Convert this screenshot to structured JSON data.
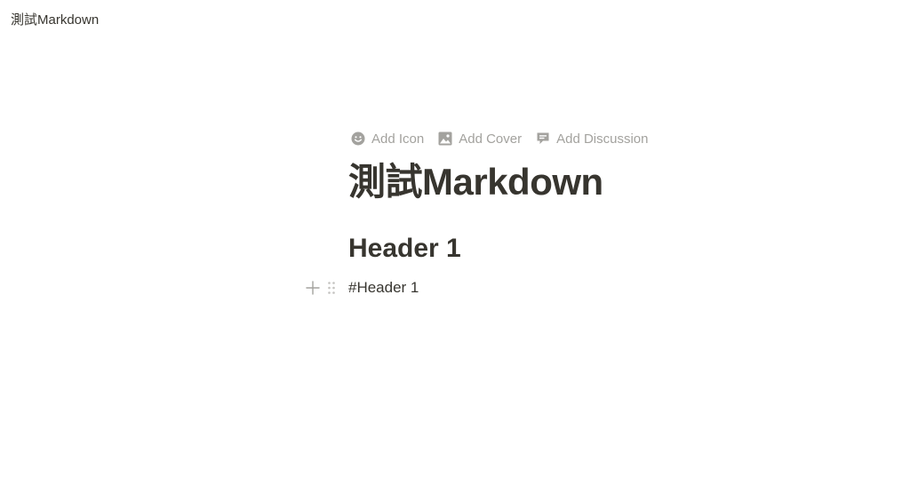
{
  "topbar": {
    "breadcrumb": "測試Markdown"
  },
  "page_controls": {
    "add_icon_label": "Add Icon",
    "add_cover_label": "Add Cover",
    "add_discussion_label": "Add Discussion"
  },
  "page": {
    "title": "測試Markdown",
    "blocks": [
      {
        "type": "header",
        "text": "Header 1"
      },
      {
        "type": "text",
        "text": "#Header 1"
      }
    ]
  },
  "icons": {
    "add_icon": "smiley-face-icon",
    "add_cover": "image-icon",
    "add_discussion": "comment-icon",
    "plus": "plus-icon",
    "drag": "drag-handle-icon"
  },
  "colors": {
    "text": "#37352f",
    "muted": "#a3a29e",
    "background": "#ffffff"
  }
}
